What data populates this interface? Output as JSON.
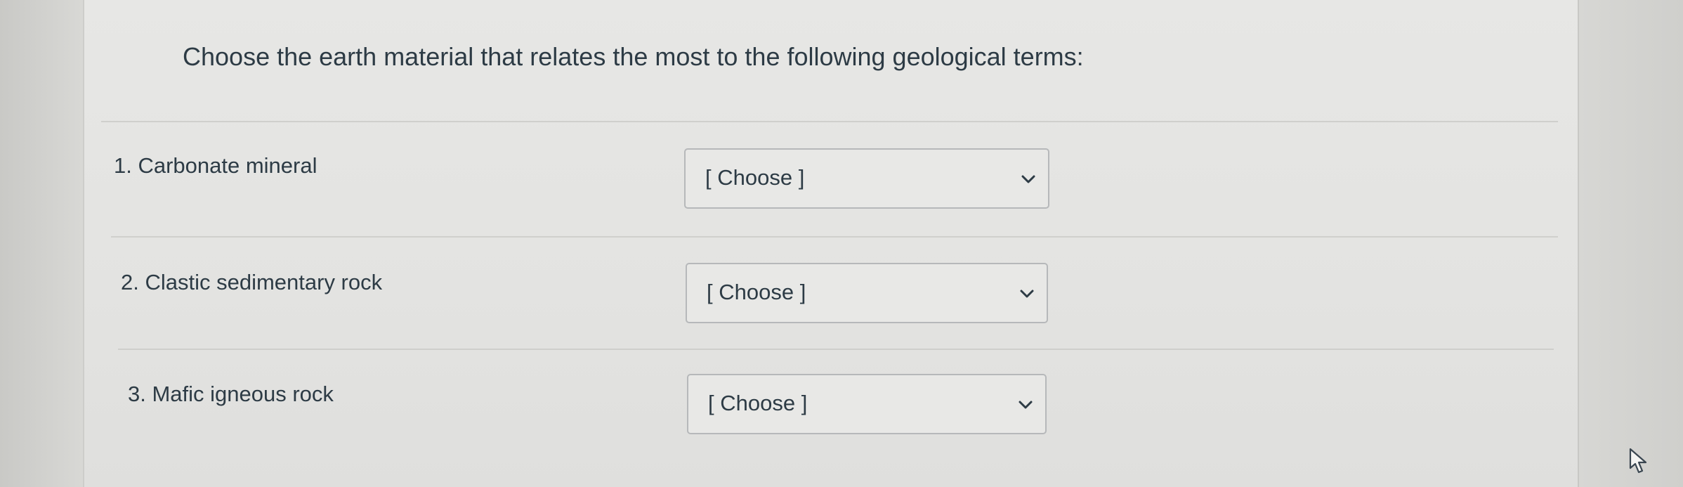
{
  "question": {
    "text": "Choose the earth material that relates the most to the following geological terms:"
  },
  "rows": [
    {
      "term": "1. Carbonate mineral",
      "selected": "[ Choose ]"
    },
    {
      "term": "2. Clastic sedimentary rock",
      "selected": "[ Choose ]"
    },
    {
      "term": "3. Mafic igneous rock",
      "selected": "[ Choose ]"
    }
  ],
  "colors": {
    "text": "#2d3b45",
    "card_background": "#e5e5e3",
    "select_border": "#b6b8ba"
  },
  "icons": {
    "dropdown": "chevron-down-icon",
    "cursor": "mouse-pointer-icon"
  }
}
